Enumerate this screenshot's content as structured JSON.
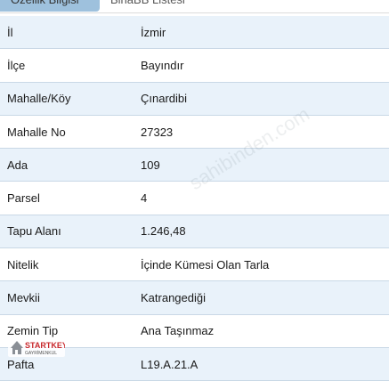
{
  "tabs": [
    {
      "label": "Özellik Bilgisi",
      "active": true
    },
    {
      "label": "BinaBB Listesi",
      "active": false
    }
  ],
  "rows": [
    {
      "label": "İl",
      "value": "İzmir"
    },
    {
      "label": "İlçe",
      "value": "Bayındır"
    },
    {
      "label": "Mahalle/Köy",
      "value": "Çınardibi"
    },
    {
      "label": "Mahalle No",
      "value": "27323"
    },
    {
      "label": "Ada",
      "value": "109"
    },
    {
      "label": "Parsel",
      "value": "4"
    },
    {
      "label": "Tapu Alanı",
      "value": "1.246,48"
    },
    {
      "label": "Nitelik",
      "value": "İçinde Kümesi Olan Tarla"
    },
    {
      "label": "Mevkii",
      "value": "Katrangediği"
    },
    {
      "label": "Zemin Tip",
      "value": "Ana Taşınmaz"
    },
    {
      "label": "Pafta",
      "value": "L19.A.21.A"
    }
  ],
  "watermark": "sahibinden.com",
  "logo": {
    "brand": "STARTKEY",
    "tagline": "GAYRİMENKUL"
  },
  "colors": {
    "tab_active_bg": "#9ec1dd",
    "row_alt_bg": "#e9f2fa",
    "row_border": "#c9d8e6",
    "logo_red": "#c8282d"
  }
}
